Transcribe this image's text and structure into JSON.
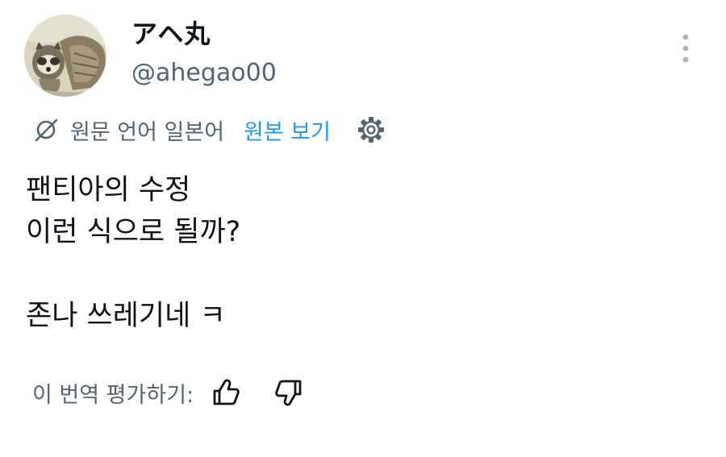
{
  "user": {
    "display_name": "アヘ丸",
    "handle": "@ahegao00",
    "avatar_icon": "raccoon-dog-avatar"
  },
  "menu": {
    "more_icon": "vertical-ellipsis-icon"
  },
  "translation": {
    "source_label": "원문 언어 일본어",
    "view_original_label": "원본 보기",
    "translate_icon": "translate-icon",
    "settings_icon": "gear-icon",
    "link_color": "#1d9bf0",
    "muted_color": "#536471"
  },
  "tweet": {
    "lines": [
      "팬티아의 수정",
      "이런 식으로 될까?",
      "",
      "존나 쓰레기네 ㅋ"
    ]
  },
  "rating": {
    "label": "이 번역 평가하기:",
    "thumbs_up_icon": "thumbs-up-icon",
    "thumbs_down_icon": "thumbs-down-icon"
  }
}
